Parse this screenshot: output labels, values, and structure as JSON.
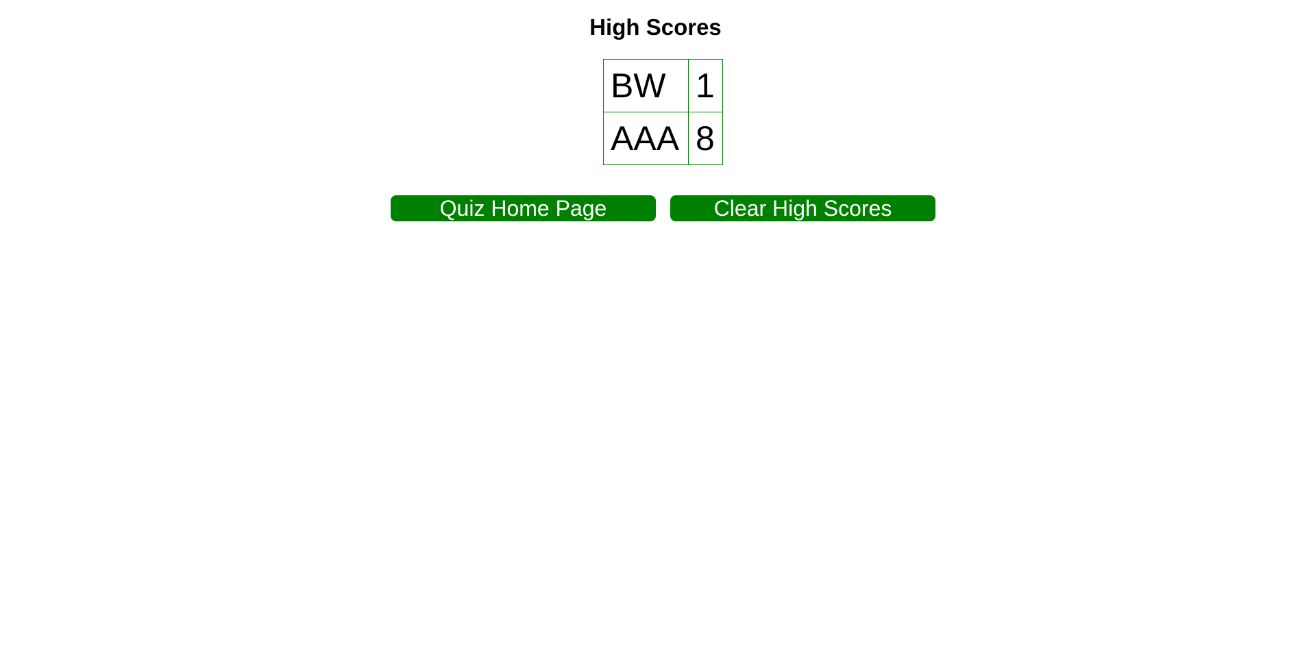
{
  "page": {
    "title": "High Scores"
  },
  "scores": [
    {
      "initials": "BW",
      "score": "1"
    },
    {
      "initials": "AAA",
      "score": "8"
    }
  ],
  "buttons": {
    "home_label": "Quiz Home Page",
    "clear_label": "Clear High Scores"
  },
  "colors": {
    "accent": "#008000",
    "button_text": "#ffffff",
    "background": "#ffffff"
  }
}
